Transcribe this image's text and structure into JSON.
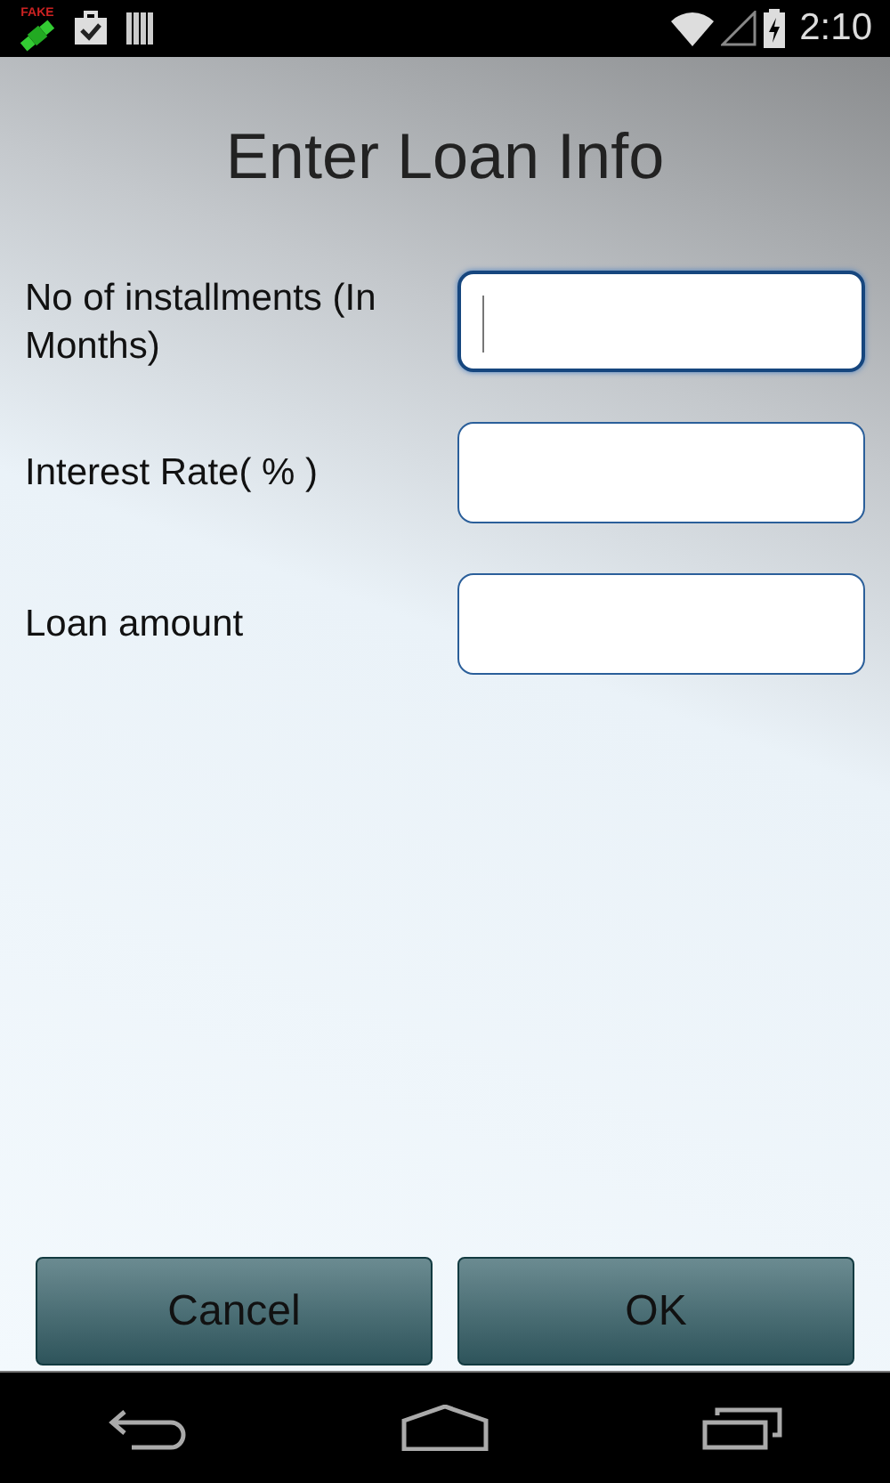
{
  "status_bar": {
    "notification_label": "FAKE",
    "time": "2:10"
  },
  "title": "Enter Loan Info",
  "fields": [
    {
      "label": "No of installments (In Months)",
      "focused": true
    },
    {
      "label": "Interest Rate( % )",
      "focused": false
    },
    {
      "label": "Loan amount",
      "focused": false
    }
  ],
  "buttons": [
    "Cancel",
    "OK"
  ]
}
